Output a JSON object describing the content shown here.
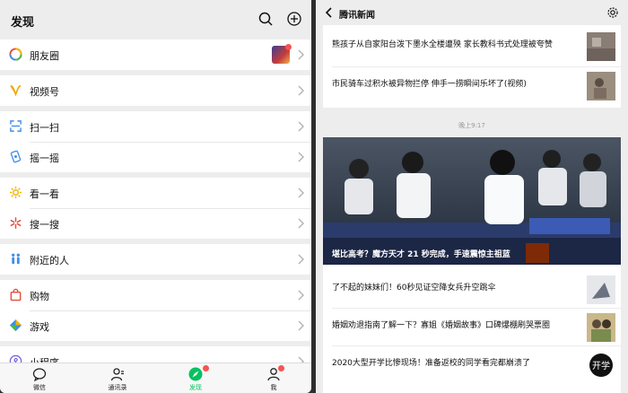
{
  "left": {
    "title": "发现",
    "groups": [
      [
        {
          "label": "朋友圈",
          "icon": "moments-icon"
        }
      ],
      [
        {
          "label": "视频号",
          "icon": "channels-icon"
        }
      ],
      [
        {
          "label": "扫一扫",
          "icon": "scan-icon"
        },
        {
          "label": "摇一摇",
          "icon": "shake-icon"
        }
      ],
      [
        {
          "label": "看一看",
          "icon": "top-stories-icon"
        },
        {
          "label": "搜一搜",
          "icon": "search-star-icon"
        }
      ],
      [
        {
          "label": "附近的人",
          "icon": "people-nearby-icon"
        }
      ],
      [
        {
          "label": "购物",
          "icon": "shopping-bag-icon"
        },
        {
          "label": "游戏",
          "icon": "games-icon"
        }
      ],
      [
        {
          "label": "小程序",
          "icon": "mini-programs-icon"
        }
      ]
    ],
    "tabs": [
      {
        "label": "微信",
        "icon": "chat-icon"
      },
      {
        "label": "通讯录",
        "icon": "contacts-icon"
      },
      {
        "label": "发现",
        "icon": "discover-icon"
      },
      {
        "label": "我",
        "icon": "me-icon"
      }
    ]
  },
  "right": {
    "title": "腾讯新闻",
    "top_items": [
      {
        "text": "熊孩子从自家阳台泼下墨水全楼遭殃 家长教科书式处理被夸赞"
      },
      {
        "text": "市民骑车过积水被异物拦停 伸手一捞瞬间乐坏了(视频)"
      }
    ],
    "time": "晚上9:17",
    "hero_caption": "堪比高考？魔方天才 21 秒完成，手速震惊主祖蓝",
    "items": [
      {
        "text": "了不起的妹妹们！60秒见证空降女兵升空跳伞"
      },
      {
        "text": "婚姻劝退指南了解一下？寡姐《婚姻故事》口碑爆棚刷哭票圈"
      },
      {
        "text": "2020大型开学比惨现场！准备返校的同学看完都崩溃了"
      }
    ],
    "thumb_text": "开学"
  }
}
